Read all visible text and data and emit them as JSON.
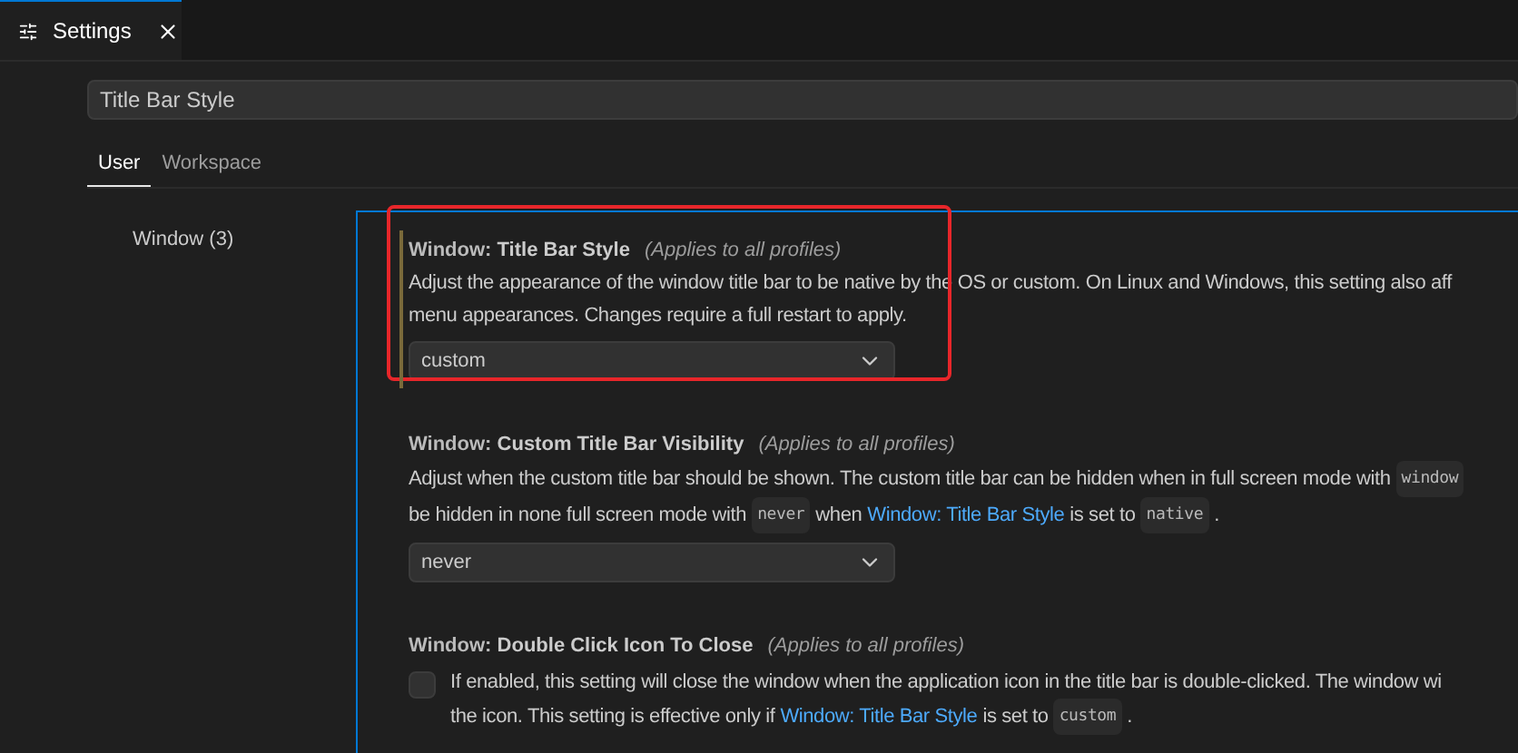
{
  "editor_tab": {
    "title": "Settings",
    "selected": true
  },
  "search": {
    "value": "Title Bar Style"
  },
  "scope_tabs": [
    {
      "label": "User",
      "selected": true
    },
    {
      "label": "Workspace",
      "selected": false
    }
  ],
  "toc": [
    {
      "label": "Window (3)"
    }
  ],
  "settings": [
    {
      "kind": "dropdown",
      "category": "Window: ",
      "name": "Title Bar Style",
      "scope": "(Applies to all profiles)",
      "focused": true,
      "annotated": true,
      "value": "custom",
      "description": [
        [
          {
            "kind": "text",
            "text": "Adjust the appearance of the window title bar to be native by the OS or custom. On Linux and Windows, this setting also aff"
          }
        ],
        [
          {
            "kind": "text",
            "text": "menu appearances. Changes require a full restart to apply."
          }
        ]
      ]
    },
    {
      "kind": "dropdown",
      "category": "Window: ",
      "name": "Custom Title Bar Visibility",
      "scope": "(Applies to all profiles)",
      "focused": false,
      "annotated": false,
      "value": "never",
      "description": [
        [
          {
            "kind": "text",
            "text": "Adjust when the custom title bar should be shown. The custom title bar can be hidden when in full screen mode with"
          },
          {
            "kind": "code",
            "text": "window"
          }
        ],
        [
          {
            "kind": "text",
            "text": "be hidden in none full screen mode with"
          },
          {
            "kind": "code",
            "text": "never"
          },
          {
            "kind": "text",
            "text": "when"
          },
          {
            "kind": "link",
            "text": "Window: Title Bar Style"
          },
          {
            "kind": "text",
            "text": "is set to"
          },
          {
            "kind": "code",
            "text": "native"
          },
          {
            "kind": "text",
            "text": "."
          }
        ]
      ]
    },
    {
      "kind": "checkbox",
      "category": "Window: ",
      "name": "Double Click Icon To Close",
      "scope": "(Applies to all profiles)",
      "focused": false,
      "annotated": false,
      "checked": false,
      "description": [
        [
          {
            "kind": "text",
            "text": "If enabled, this setting will close the window when the application icon in the title bar is double-clicked. The window wi"
          }
        ],
        [
          {
            "kind": "text",
            "text": "the icon. This setting is effective only if"
          },
          {
            "kind": "link",
            "text": "Window: Title Bar Style"
          },
          {
            "kind": "text",
            "text": "is set to"
          },
          {
            "kind": "code",
            "text": "custom"
          },
          {
            "kind": "text",
            "text": "."
          }
        ]
      ]
    }
  ]
}
